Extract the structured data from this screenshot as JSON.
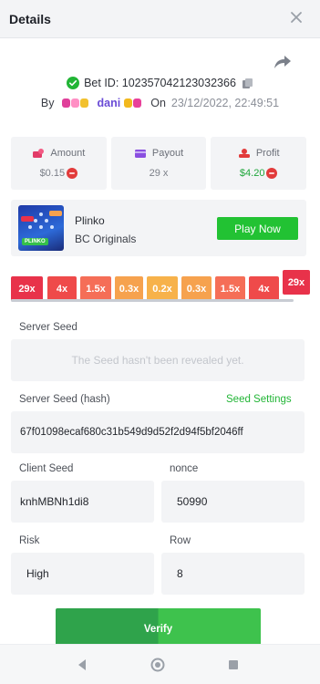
{
  "header": {
    "title": "Details"
  },
  "bet": {
    "id_text": "Bet ID: 102357042123032366",
    "by_label": "By",
    "username": "dani",
    "on_label": "On",
    "datetime": "23/12/2022, 22:49:51"
  },
  "stats": {
    "amount": {
      "label": "Amount",
      "value": "$0.15"
    },
    "payout": {
      "label": "Payout",
      "value": "29 x"
    },
    "profit": {
      "label": "Profit",
      "value": "$4.20"
    }
  },
  "game": {
    "name": "Plinko",
    "provider": "BC Originals",
    "play_label": "Play Now",
    "thumb_tag": "PLINKO"
  },
  "multipliers": [
    "29x",
    "4x",
    "1.5x",
    "0.3x",
    "0.2x",
    "0.3x",
    "1.5x",
    "4x",
    "29x"
  ],
  "multiplier_colors": [
    "#e8324a",
    "#ef4a4a",
    "#f56e57",
    "#f6a24e",
    "#f7b24a",
    "#f6a24e",
    "#f56e57",
    "#ef4a4a",
    "#e8324a"
  ],
  "server_seed": {
    "label": "Server Seed",
    "placeholder": "The Seed hasn't been revealed yet."
  },
  "server_seed_hash": {
    "label": "Server Seed (hash)",
    "settings_label": "Seed Settings",
    "value": "67f01098ecaf680c31b549d9d52f2d94f5bf2046ff"
  },
  "client_seed": {
    "label": "Client Seed",
    "value": "knhMBNh1di8"
  },
  "nonce": {
    "label": "nonce",
    "value": "50990"
  },
  "risk": {
    "label": "Risk",
    "value": "High"
  },
  "row": {
    "label": "Row",
    "value": "8"
  },
  "verify_label": "Verify",
  "colors": {
    "accent_green": "#22c233",
    "link_green": "#22b536",
    "user_purple": "#6a4bd6"
  }
}
